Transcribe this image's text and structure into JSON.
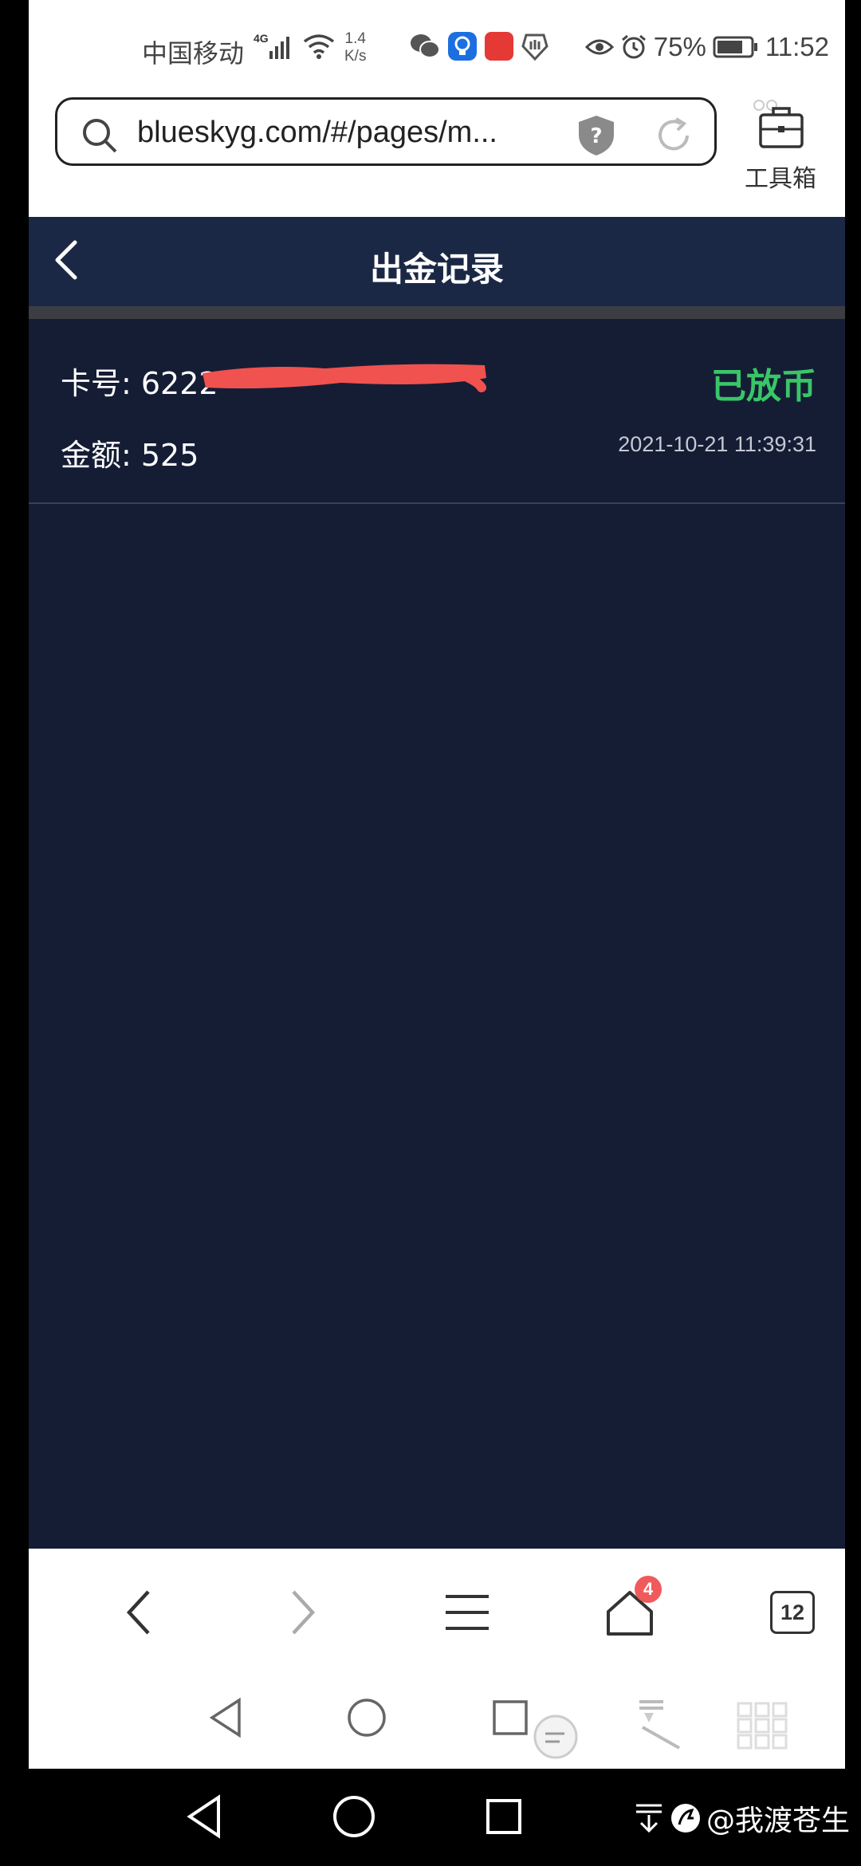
{
  "status_bar": {
    "carrier": "中国移动",
    "network": "4G",
    "speed_value": "1.4",
    "speed_unit": "K/s",
    "battery": "75%",
    "time": "11:52"
  },
  "browser": {
    "url": "blueskyg.com/#/pages/m...",
    "toolbox_label": "工具箱",
    "tab_badge": "4",
    "tab_count": "12"
  },
  "header": {
    "title": "出金记录"
  },
  "records": [
    {
      "card_label": "卡号: 6222",
      "amount_label": "金额: 525",
      "status": "已放币",
      "time": "2021-10-21 11:39:31"
    }
  ],
  "watermark": "@我渡苍生",
  "colors": {
    "header_bg": "#1b2845",
    "content_bg": "#151d35",
    "status_green": "#39c667",
    "redaction": "#f0524f"
  }
}
